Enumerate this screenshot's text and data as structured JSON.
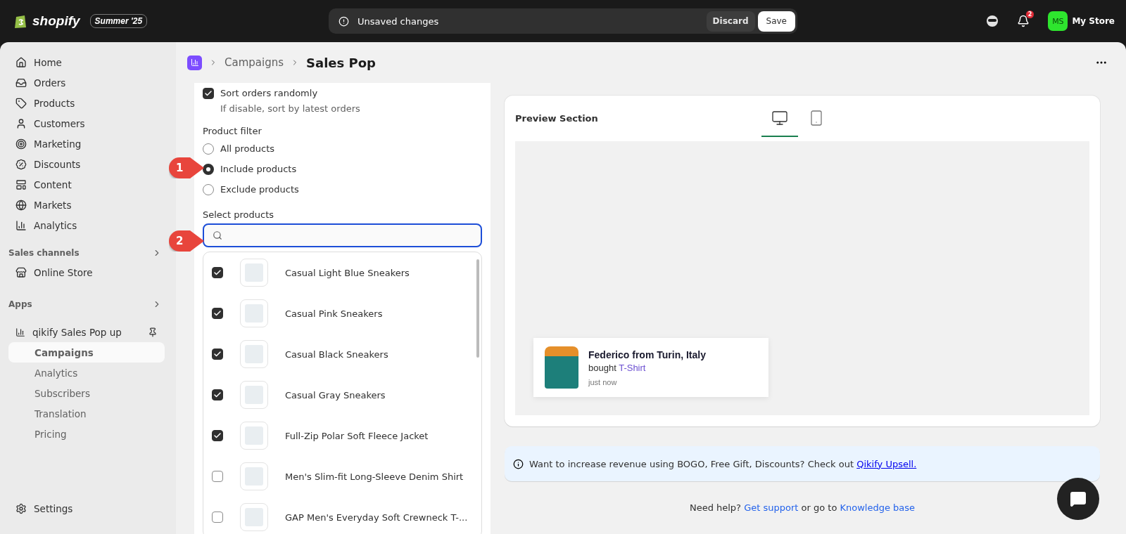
{
  "topbar": {
    "brand": "shopify",
    "edition": "Summer '25",
    "notice": "Unsaved changes",
    "discard": "Discard",
    "save": "Save",
    "notification_count": "2",
    "avatar": "MS",
    "store": "My Store"
  },
  "sidebar": {
    "items": [
      {
        "label": "Home",
        "selected": false
      },
      {
        "label": "Orders",
        "selected": false
      },
      {
        "label": "Products",
        "selected": false
      },
      {
        "label": "Customers",
        "selected": false
      },
      {
        "label": "Marketing",
        "selected": false
      },
      {
        "label": "Discounts",
        "selected": false
      },
      {
        "label": "Content",
        "selected": false
      },
      {
        "label": "Markets",
        "selected": false
      },
      {
        "label": "Analytics",
        "selected": false
      }
    ],
    "sales_channels": {
      "title": "Sales channels",
      "items": [
        {
          "label": "Online Store",
          "selected": false
        }
      ]
    },
    "apps": {
      "title": "Apps",
      "app": {
        "name": "qikify Sales Pop up",
        "children": [
          {
            "label": "Campaigns",
            "selected": true
          },
          {
            "label": "Analytics",
            "selected": false
          },
          {
            "label": "Subscribers",
            "selected": false
          },
          {
            "label": "Translation",
            "selected": false
          },
          {
            "label": "Pricing",
            "selected": false
          }
        ]
      }
    },
    "settings": "Settings"
  },
  "header": {
    "breadcrumb": "Campaigns",
    "title": "Sales Pop"
  },
  "settings_panel": {
    "sort": {
      "label": "Sort orders randomly",
      "checked": true,
      "hint": "If disable, sort by latest orders"
    },
    "product_filter": {
      "label": "Product filter",
      "options": [
        {
          "label": "All products",
          "selected": false
        },
        {
          "label": "Include products",
          "selected": true
        },
        {
          "label": "Exclude products",
          "selected": false
        }
      ]
    },
    "select_products": {
      "label": "Select products"
    },
    "products": [
      {
        "name": "Casual Light Blue Sneakers",
        "checked": true
      },
      {
        "name": "Casual Pink Sneakers",
        "checked": true
      },
      {
        "name": "Casual Black Sneakers",
        "checked": true
      },
      {
        "name": "Casual Gray Sneakers",
        "checked": true
      },
      {
        "name": "Full-Zip Polar Soft Fleece Jacket",
        "checked": true
      },
      {
        "name": "Men's Slim-fit Long-Sleeve Denim Shirt",
        "checked": false
      },
      {
        "name": "GAP Men's Everyday Soft Crewneck T-...",
        "checked": false
      }
    ]
  },
  "annotations": [
    "1",
    "2"
  ],
  "preview": {
    "title": "Preview Section",
    "device_tabs": [
      {
        "kind": "desktop",
        "selected": true
      },
      {
        "kind": "mobile",
        "selected": false
      }
    ],
    "popup": {
      "headline": "Federico from Turin, Italy",
      "verb": "bought",
      "product": "T-Shirt",
      "time": "just now"
    }
  },
  "banner": {
    "text": "Want to increase revenue using BOGO, Free Gift, Discounts? Check out",
    "link": "Qikify Upsell."
  },
  "help": {
    "prefix": "Need help?",
    "support": "Get support",
    "middle": "or go to",
    "knowledge": "Knowledge base"
  }
}
